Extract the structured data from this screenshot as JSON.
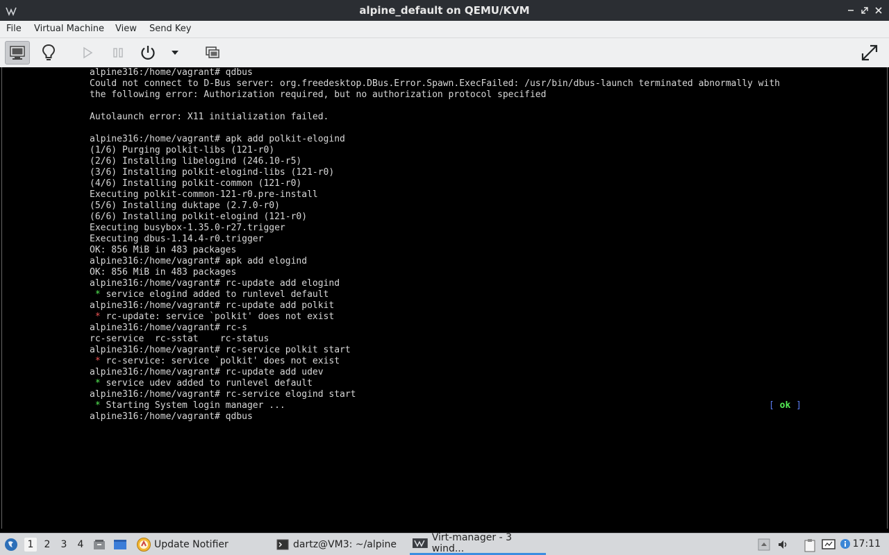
{
  "window": {
    "title": "alpine_default on QEMU/KVM"
  },
  "menu": [
    "File",
    "Virtual Machine",
    "View",
    "Send Key"
  ],
  "console": {
    "lines": [
      {
        "text": "alpine316:/home/vagrant# qdbus"
      },
      {
        "text": "Could not connect to D-Bus server: org.freedesktop.DBus.Error.Spawn.ExecFailed: /usr/bin/dbus-launch terminated abnormally with"
      },
      {
        "text": "the following error: Authorization required, but no authorization protocol specified"
      },
      {
        "text": ""
      },
      {
        "text": "Autolaunch error: X11 initialization failed."
      },
      {
        "text": ""
      },
      {
        "text": "alpine316:/home/vagrant# apk add polkit-elogind"
      },
      {
        "text": "(1/6) Purging polkit-libs (121-r0)"
      },
      {
        "text": "(2/6) Installing libelogind (246.10-r5)"
      },
      {
        "text": "(3/6) Installing polkit-elogind-libs (121-r0)"
      },
      {
        "text": "(4/6) Installing polkit-common (121-r0)"
      },
      {
        "text": "Executing polkit-common-121-r0.pre-install"
      },
      {
        "text": "(5/6) Installing duktape (2.7.0-r0)"
      },
      {
        "text": "(6/6) Installing polkit-elogind (121-r0)"
      },
      {
        "text": "Executing busybox-1.35.0-r27.trigger"
      },
      {
        "text": "Executing dbus-1.14.4-r0.trigger"
      },
      {
        "text": "OK: 856 MiB in 483 packages"
      },
      {
        "text": "alpine316:/home/vagrant# apk add elogind"
      },
      {
        "text": "OK: 856 MiB in 483 packages"
      },
      {
        "text": "alpine316:/home/vagrant# rc-update add elogind"
      },
      {
        "star": "green",
        "text": " service elogind added to runlevel default"
      },
      {
        "text": "alpine316:/home/vagrant# rc-update add polkit"
      },
      {
        "star": "red",
        "text": " rc-update: service `polkit' does not exist"
      },
      {
        "text": "alpine316:/home/vagrant# rc-s"
      },
      {
        "text": "rc-service  rc-sstat    rc-status"
      },
      {
        "text": "alpine316:/home/vagrant# rc-service polkit start"
      },
      {
        "star": "red",
        "text": " rc-service: service `polkit' does not exist"
      },
      {
        "text": "alpine316:/home/vagrant# rc-update add udev"
      },
      {
        "star": "green",
        "text": " service udev added to runlevel default"
      },
      {
        "text": "alpine316:/home/vagrant# rc-service elogind start"
      },
      {
        "star": "green",
        "text": " Starting System login manager ..."
      },
      {
        "text": "alpine316:/home/vagrant# qdbus"
      }
    ],
    "ok_open": "[ ",
    "ok_text": "ok",
    "ok_close": " ]",
    "star_glyph": "*"
  },
  "taskbar": {
    "workspaces": [
      "1",
      "2",
      "3",
      "4"
    ],
    "active_workspace": "1",
    "tasks": [
      {
        "label": "Update Notifier",
        "icon": "update-notifier-icon"
      },
      {
        "label": "dartz@VM3: ~/alpine",
        "icon": "terminal-icon"
      },
      {
        "label": "Virt-manager - 3 wind...",
        "icon": "virt-manager-icon",
        "active": true
      }
    ],
    "clock": "17:11"
  },
  "colors": {
    "titlebar": "#2b2e33",
    "accent": "#3d8ee0",
    "ok_green": "#55ee55",
    "error_red": "#ee5555"
  }
}
